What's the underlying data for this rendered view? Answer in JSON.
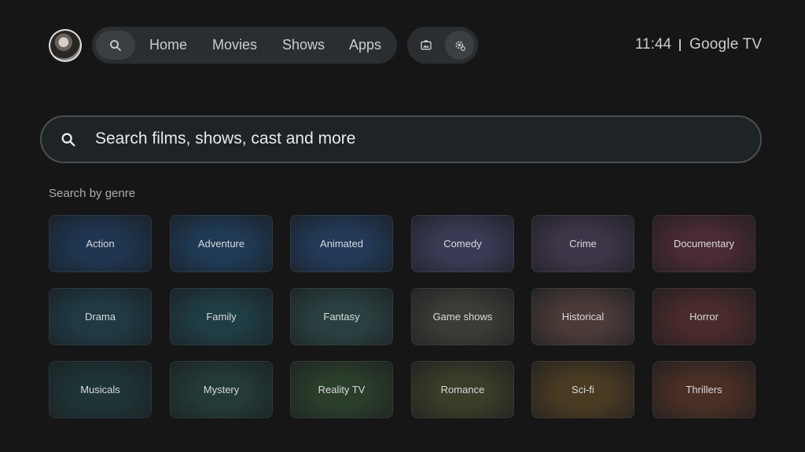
{
  "nav": {
    "items": [
      "Home",
      "Movies",
      "Shows",
      "Apps"
    ]
  },
  "status": {
    "time": "11:44",
    "brand": "Google TV"
  },
  "search": {
    "placeholder": "Search films, shows, cast and more"
  },
  "genres_section": {
    "title": "Search by genre",
    "items": [
      {
        "label": "Action",
        "color": "#1f3550"
      },
      {
        "label": "Adventure",
        "color": "#1f3a55"
      },
      {
        "label": "Animated",
        "color": "#223a58"
      },
      {
        "label": "Comedy",
        "color": "#3a3a55"
      },
      {
        "label": "Crime",
        "color": "#3f3548"
      },
      {
        "label": "Documentary",
        "color": "#4a2a33"
      },
      {
        "label": "Drama",
        "color": "#1f3a44"
      },
      {
        "label": "Family",
        "color": "#1f3d44"
      },
      {
        "label": "Fantasy",
        "color": "#2a4040"
      },
      {
        "label": "Game shows",
        "color": "#3d3b36"
      },
      {
        "label": "Historical",
        "color": "#4a3a38"
      },
      {
        "label": "Horror",
        "color": "#4a2a2a"
      },
      {
        "label": "Musicals",
        "color": "#1f3436"
      },
      {
        "label": "Mystery",
        "color": "#243a36"
      },
      {
        "label": "Reality TV",
        "color": "#2b3e2a"
      },
      {
        "label": "Romance",
        "color": "#3a3d27"
      },
      {
        "label": "Sci-fi",
        "color": "#4a3a22"
      },
      {
        "label": "Thrillers",
        "color": "#4a2f24"
      }
    ]
  },
  "icons": {
    "nav_search": "search-icon",
    "photos": "photo-frame-icon",
    "settings": "settings-gear-icon",
    "field_search": "search-icon"
  }
}
